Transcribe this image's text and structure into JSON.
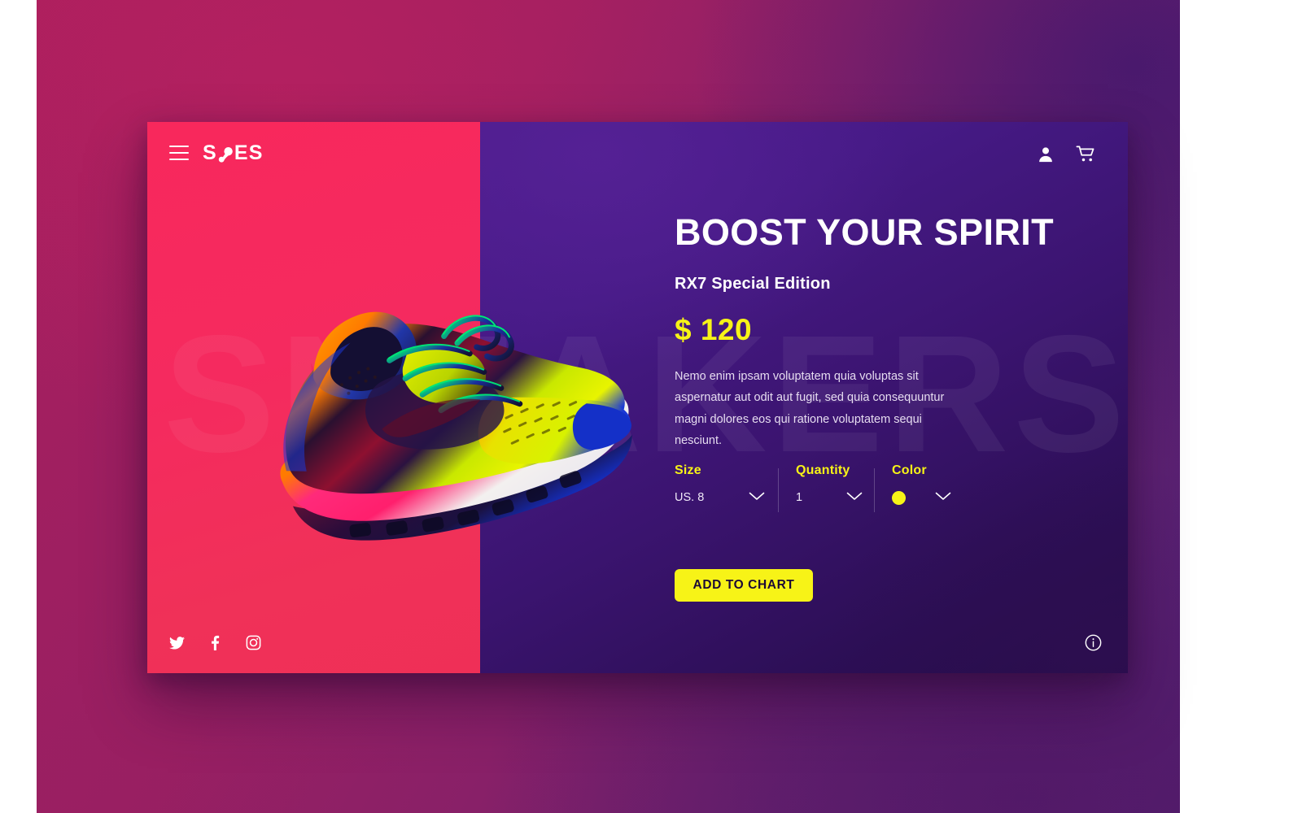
{
  "brand": {
    "logo_text_start": "S",
    "logo_mark": "shoe-mark",
    "logo_text_end": "ES",
    "logo_full": "SHOES"
  },
  "header": {
    "menu_icon": "hamburger-icon",
    "account_icon": "user-icon",
    "cart_icon": "shopping-cart-icon"
  },
  "watermark": {
    "text": "SNEAKERS"
  },
  "product": {
    "title": "BOOST YOUR SPIRIT",
    "subtitle": "RX7 Special Edition",
    "price": "$ 120",
    "description": "Nemo enim ipsam voluptatem quia voluptas sit aspernatur aut odit aut fugit, sed quia consequuntur magni dolores eos qui ratione voluptatem sequi nesciunt.",
    "image_alt": "neon-running-sneaker"
  },
  "options": [
    {
      "label": "Size",
      "value": "US. 8",
      "chevron": "chevron-down-icon"
    },
    {
      "label": "Quantity",
      "value": "1",
      "chevron": "chevron-down-icon"
    },
    {
      "label": "Color",
      "value": "",
      "swatch": "#f7f317",
      "chevron": "chevron-down-icon"
    }
  ],
  "cta": {
    "label": "ADD TO CHART"
  },
  "social": [
    {
      "name": "twitter-icon"
    },
    {
      "name": "facebook-icon"
    },
    {
      "name": "instagram-icon"
    }
  ],
  "info": {
    "icon": "info-circle-icon"
  },
  "colors": {
    "accent_yellow": "#f7f317",
    "panel_pink": "#f8285c",
    "panel_purple": "#3b1470",
    "page_bg_from": "#a81f5e",
    "page_bg_to": "#4a2277",
    "text_light": "#ffffff"
  }
}
